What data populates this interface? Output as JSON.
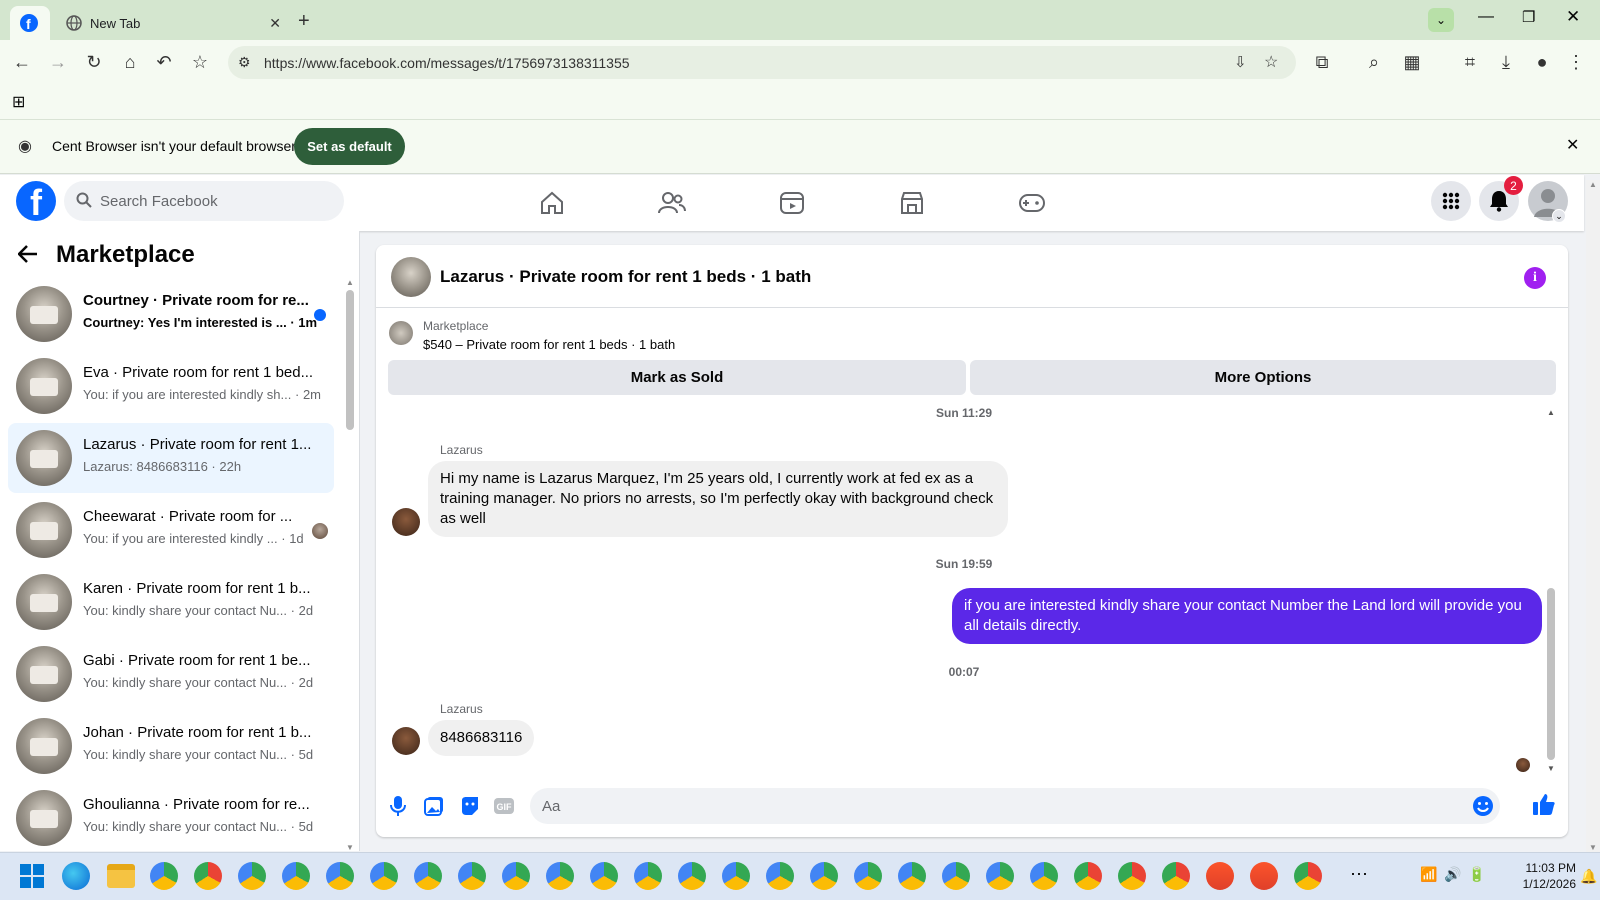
{
  "browser": {
    "tabs": [
      {
        "label": "",
        "icon": "facebook-icon",
        "active": true
      },
      {
        "label": "New Tab",
        "icon": "globe-icon",
        "active": false
      }
    ],
    "url": "https://www.facebook.com/messages/t/1756973138311355",
    "infobar_text": "Cent Browser isn't your default browser",
    "set_default_label": "Set as default"
  },
  "facebook": {
    "search_placeholder": "Search Facebook",
    "notification_count": "2",
    "brand_color": "#0866ff"
  },
  "sidebar": {
    "title": "Marketplace",
    "conversations": [
      {
        "name": "Courtney · Private room for re...",
        "snippet": "Courtney: Yes I'm interested is ...",
        "time": "1m",
        "unread": true
      },
      {
        "name": "Eva · Private room for rent 1 bed...",
        "snippet": "You: if you are interested kindly sh...",
        "time": "2m"
      },
      {
        "name": "Lazarus · Private room for rent 1...",
        "snippet": "Lazarus: 8486683116",
        "time": "22h",
        "active": true
      },
      {
        "name": "Cheewarat · Private room for ...",
        "snippet": "You: if you are interested kindly ...",
        "time": "1d",
        "seen": true
      },
      {
        "name": "Karen · Private room for rent 1 b...",
        "snippet": "You: kindly share your contact Nu...",
        "time": "2d"
      },
      {
        "name": "Gabi · Private room for rent 1 be...",
        "snippet": "You: kindly share your contact Nu...",
        "time": "2d"
      },
      {
        "name": "Johan · Private room for rent 1 b...",
        "snippet": "You: kindly share your contact Nu...",
        "time": "5d"
      },
      {
        "name": "Ghoulianna · Private room for re...",
        "snippet": "You: kindly share your contact Nu...",
        "time": "5d"
      }
    ]
  },
  "chat": {
    "title": "Lazarus · Private room for rent 1 beds · 1 bath",
    "listing_label": "Marketplace",
    "listing_title": "$540 – Private room for rent 1 beds · 1 bath",
    "mark_sold_label": "Mark as Sold",
    "more_options_label": "More Options",
    "messages": [
      {
        "timestamp": "Sun 11:29"
      },
      {
        "sender": "Lazarus",
        "text": "Hi my name is Lazarus Marquez, I'm 25 years old, I currently work at fed ex as a training manager. No priors no arrests, so I'm perfectly okay with background check as well"
      },
      {
        "timestamp": "Sun 19:59"
      },
      {
        "text": "if you are interested kindly share your contact Number the Land lord will provide you all details directly.",
        "outgoing": true
      },
      {
        "timestamp": "00:07"
      },
      {
        "sender": "Lazarus",
        "text": "8486683116"
      }
    ],
    "composer_placeholder": "Aa",
    "outgoing_color": "#5b28e8"
  },
  "taskbar": {
    "time": "11:03 PM",
    "date": "1/12/2026"
  }
}
